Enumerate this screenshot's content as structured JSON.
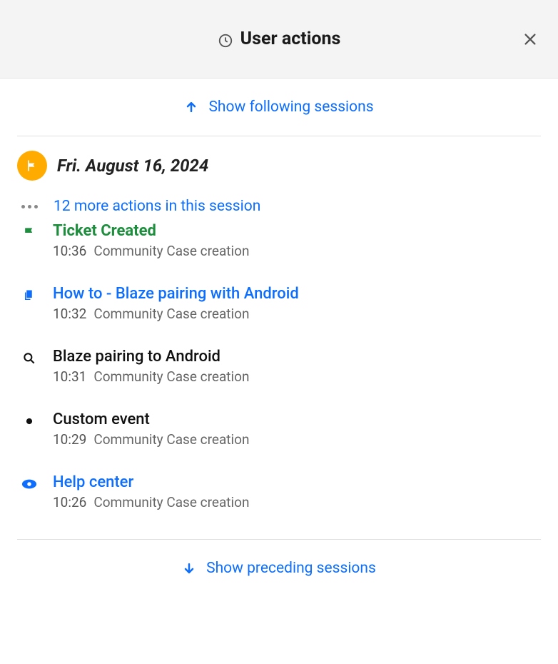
{
  "header": {
    "title": "User actions"
  },
  "links": {
    "following": "Show following sessions",
    "preceding": "Show preceding sessions"
  },
  "session": {
    "date": "Fri. August 16, 2024",
    "more_actions": "12 more actions in this session",
    "items": [
      {
        "title": "Ticket Created",
        "time": "10:36",
        "desc": "Community Case creation",
        "style": "green",
        "icon": "flag"
      },
      {
        "title": "How to - Blaze pairing with Android",
        "time": "10:32",
        "desc": "Community Case creation",
        "style": "blue",
        "icon": "page"
      },
      {
        "title": "Blaze pairing to Android",
        "time": "10:31",
        "desc": "Community Case creation",
        "style": "black",
        "icon": "search"
      },
      {
        "title": "Custom event",
        "time": "10:29",
        "desc": "Community Case creation",
        "style": "black",
        "icon": "dot"
      },
      {
        "title": "Help center",
        "time": "10:26",
        "desc": "Community Case creation",
        "style": "blue",
        "icon": "eye"
      }
    ]
  },
  "colors": {
    "link": "#0d6efd",
    "green": "#1e8e3e",
    "badge": "#ffab00"
  }
}
